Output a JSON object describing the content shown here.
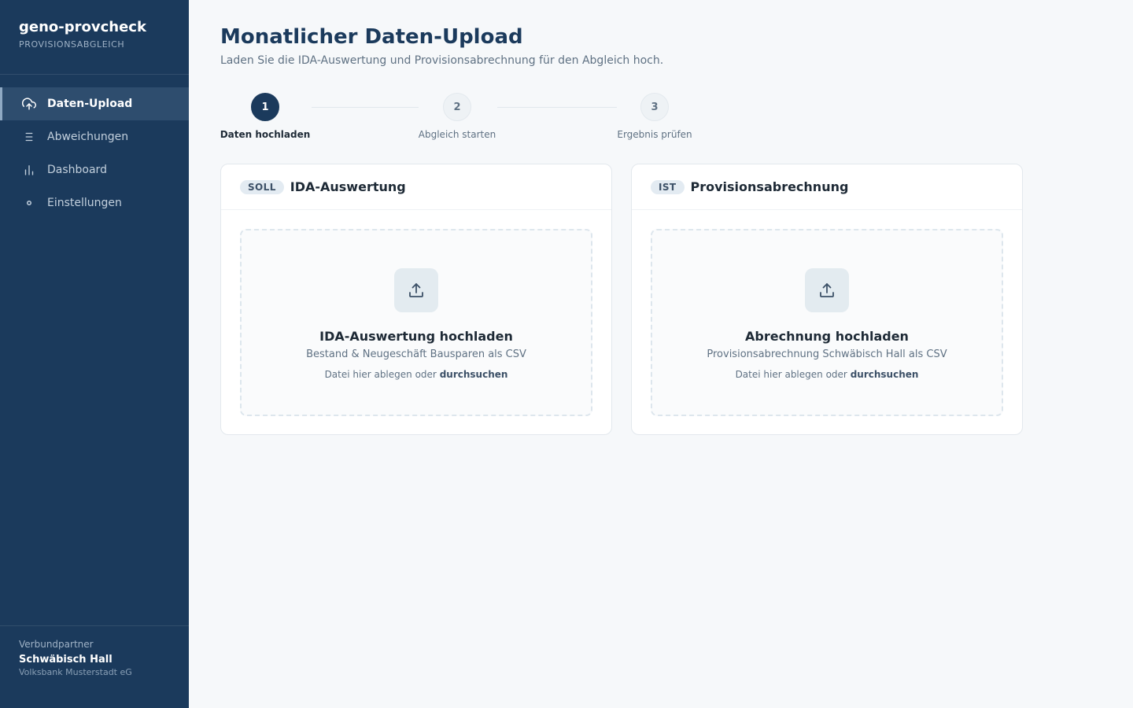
{
  "brand": {
    "title": "geno-provcheck",
    "subtitle": "PROVISIONSABGLEICH"
  },
  "nav": {
    "items": [
      {
        "label": "Daten-Upload",
        "icon": "cloud-upload-icon",
        "active": true
      },
      {
        "label": "Abweichungen",
        "icon": "list-icon",
        "active": false
      },
      {
        "label": "Dashboard",
        "icon": "bar-chart-icon",
        "active": false
      },
      {
        "label": "Einstellungen",
        "icon": "settings-icon",
        "active": false
      }
    ]
  },
  "footer": {
    "label": "Verbundpartner",
    "partner": "Schwäbisch Hall",
    "bank": "Volksbank Musterstadt eG"
  },
  "page": {
    "title": "Monatlicher Daten-Upload",
    "subtitle": "Laden Sie die IDA-Auswertung und Provisionsabrechnung für den Abgleich hoch."
  },
  "stepper": {
    "steps": [
      {
        "number": "1",
        "label": "Daten hochladen",
        "active": true
      },
      {
        "number": "2",
        "label": "Abgleich starten",
        "active": false
      },
      {
        "number": "3",
        "label": "Ergebnis prüfen",
        "active": false
      }
    ]
  },
  "cards": [
    {
      "badge": "SOLL",
      "title": "IDA-Auswertung",
      "drop_title": "IDA-Auswertung hochladen",
      "drop_desc": "Bestand & Neugeschäft Bausparen als CSV",
      "hint_prefix": "Datei hier ablegen oder",
      "hint_link": "durchsuchen"
    },
    {
      "badge": "IST",
      "title": "Provisionsabrechnung",
      "drop_title": "Abrechnung hochladen",
      "drop_desc": "Provisionsabrechnung Schwäbisch Hall als CSV",
      "hint_prefix": "Datei hier ablegen oder",
      "hint_link": "durchsuchen"
    }
  ],
  "colors": {
    "sidebar": "#1b3a5c",
    "accent": "#1b3a5c",
    "background": "#f6f8fa"
  }
}
